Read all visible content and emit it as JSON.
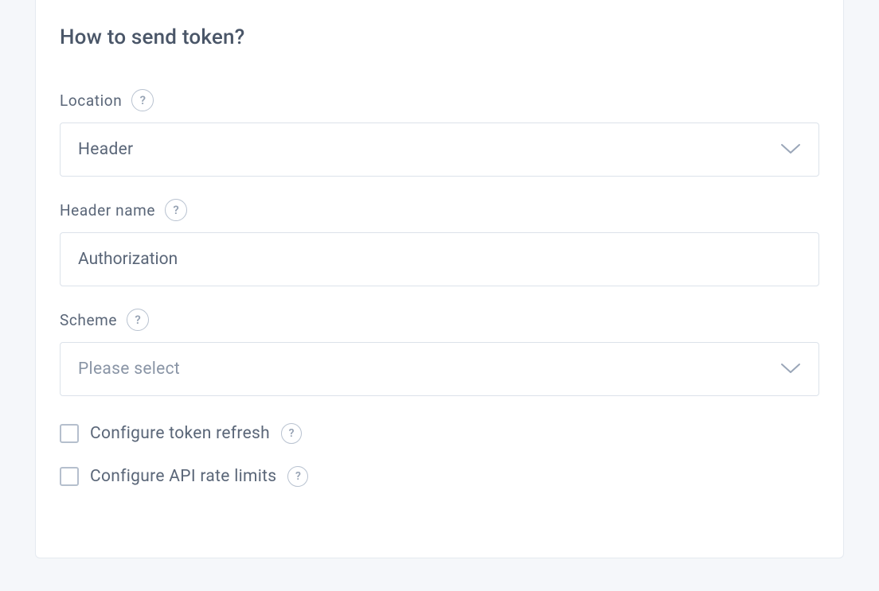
{
  "section": {
    "title": "How to send token?"
  },
  "fields": {
    "location": {
      "label": "Location",
      "value": "Header"
    },
    "headerName": {
      "label": "Header name",
      "value": "Authorization"
    },
    "scheme": {
      "label": "Scheme",
      "placeholder": "Please select"
    }
  },
  "checkboxes": {
    "tokenRefresh": {
      "label": "Configure token refresh"
    },
    "rateLimits": {
      "label": "Configure API rate limits"
    }
  },
  "icons": {
    "help": "?"
  }
}
